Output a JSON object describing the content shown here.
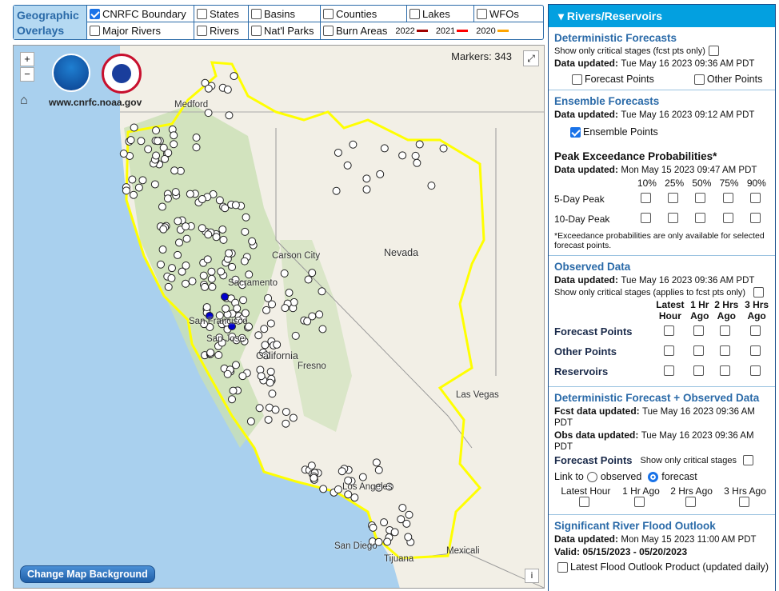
{
  "overlays": {
    "title_line1": "Geographic",
    "title_line2": "Overlays",
    "items": [
      {
        "label": "CNRFC Boundary",
        "checked": true
      },
      {
        "label": "States",
        "checked": false
      },
      {
        "label": "Basins",
        "checked": false
      },
      {
        "label": "Counties",
        "checked": false
      },
      {
        "label": "Lakes",
        "checked": false
      },
      {
        "label": "WFOs",
        "checked": false
      },
      {
        "label": "Major Rivers",
        "checked": false
      },
      {
        "label": "Rivers",
        "checked": false
      },
      {
        "label": "Nat'l Parks",
        "checked": false
      },
      {
        "label": "Burn Areas",
        "checked": false
      }
    ],
    "burn_years": [
      {
        "year": "2022",
        "color": "#a00000"
      },
      {
        "year": "2021",
        "color": "#ff0000"
      },
      {
        "year": "2020",
        "color": "#ffa500"
      }
    ]
  },
  "map": {
    "zoom_in": "+",
    "zoom_out": "−",
    "site": "www.cnrfc.noaa.gov",
    "noaa_logo": "NOAA",
    "nws_logo": "NATIONAL WEATHER SERVICE",
    "markers_label": "Markers: 343",
    "change_bg": "Change Map Background",
    "info": "i",
    "fullscreen": "⤢",
    "labels": [
      "Medford",
      "Carson City",
      "Nevada",
      "Sacramento",
      "San Francisco",
      "San Jose",
      "California",
      "Fresno",
      "Las Vegas",
      "Los Angeles",
      "San Diego",
      "Tijuana",
      "Mexicali"
    ],
    "boundary_color": "#ffff00",
    "marker_color": "#ffffff",
    "selected_marker_color": "#0000cc"
  },
  "panel": {
    "title": "Rivers/Reservoirs",
    "det": {
      "title": "Deterministic Forecasts",
      "critical": "Show only critical stages (fcst pts only)",
      "du_label": "Data updated:",
      "du": "Tue May 16 2023 09:36 AM PDT",
      "fp": "Forecast Points",
      "op": "Other Points"
    },
    "ens": {
      "title": "Ensemble Forecasts",
      "du_label": "Data updated:",
      "du": "Tue May 16 2023 09:12 AM PDT",
      "ep": "Ensemble Points"
    },
    "pep": {
      "title": "Peak Exceedance Probabilities*",
      "du_label": "Data updated:",
      "du": "Mon May 15 2023 09:47 AM PDT",
      "cols": [
        "10%",
        "25%",
        "50%",
        "75%",
        "90%"
      ],
      "rows": [
        "5-Day Peak",
        "10-Day Peak"
      ],
      "note": "*Exceedance probabilities are only available for selected forecast points."
    },
    "obs": {
      "title": "Observed Data",
      "du_label": "Data updated:",
      "du": "Tue May 16 2023 09:36 AM PDT",
      "critical": "Show only critical stages (applies to fcst pts only)",
      "cols": [
        [
          "Latest",
          "Hour"
        ],
        [
          "1 Hr",
          "Ago"
        ],
        [
          "2 Hrs",
          "Ago"
        ],
        [
          "3 Hrs",
          "Ago"
        ]
      ],
      "rows": [
        "Forecast Points",
        "Other Points",
        "Reservoirs"
      ]
    },
    "dfo": {
      "title": "Deterministic Forecast + Observed Data",
      "fdu_label": "Fcst data updated:",
      "fdu": "Tue May 16 2023 09:36 AM PDT",
      "odu_label": "Obs data updated:",
      "odu": "Tue May 16 2023 09:36 AM PDT",
      "fp": "Forecast Points",
      "critical": "Show only critical stages",
      "link_to": "Link to",
      "observed": "observed",
      "forecast": "forecast",
      "selected": "forecast",
      "cols": [
        "Latest Hour",
        "1 Hr Ago",
        "2 Hrs Ago",
        "3 Hrs Ago"
      ]
    },
    "sfo": {
      "title": "Significant River Flood Outlook",
      "du_label": "Data updated:",
      "du": "Mon May 15 2023 11:00 AM PDT",
      "valid": "Valid: 05/15/2023 - 05/20/2023",
      "latest": "Latest Flood Outlook Product (updated daily)"
    }
  }
}
